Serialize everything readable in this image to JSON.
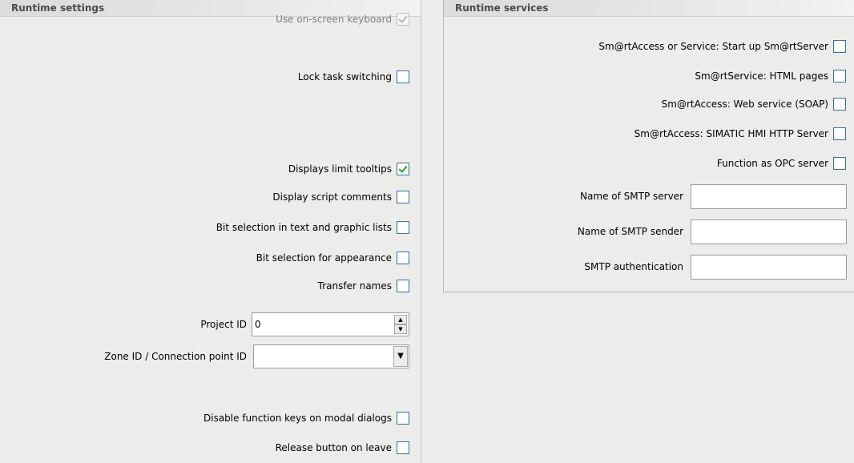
{
  "runtime_settings": {
    "title": "Runtime settings",
    "checkboxes": [
      {
        "label": "Use on-screen keyboard",
        "checked": true,
        "disabled": true
      },
      {
        "label": "Lock task switching",
        "checked": false
      },
      {
        "label": "Displays limit tooltips",
        "checked": true
      },
      {
        "label": "Display script comments",
        "checked": false
      },
      {
        "label": "Bit selection in text and graphic lists",
        "checked": false
      },
      {
        "label": "Bit selection for appearance",
        "checked": false
      },
      {
        "label": "Transfer names",
        "checked": false
      }
    ],
    "project_id": {
      "label": "Project ID",
      "value": "0"
    },
    "zone_id": {
      "label": "Zone ID / Connection point ID",
      "value": ""
    },
    "bottom_checkboxes": [
      {
        "label": "Disable function keys on modal dialogs",
        "checked": false
      },
      {
        "label": "Release button on leave",
        "checked": false
      }
    ]
  },
  "runtime_services": {
    "title": "Runtime services",
    "checkboxes": [
      {
        "label": "Sm@rtAccess or Service: Start up Sm@rtServer",
        "checked": false
      },
      {
        "label": "Sm@rtService: HTML pages",
        "checked": false
      },
      {
        "label": "Sm@rtAccess: Web service (SOAP)",
        "checked": false
      },
      {
        "label": "Sm@rtAccess: SIMATIC HMI HTTP Server",
        "checked": false
      },
      {
        "label": "Function as OPC server",
        "checked": false
      }
    ],
    "fields": [
      {
        "label": "Name of SMTP server",
        "value": ""
      },
      {
        "label": "Name of SMTP sender",
        "value": ""
      },
      {
        "label": "SMTP authentication",
        "value": ""
      }
    ]
  }
}
